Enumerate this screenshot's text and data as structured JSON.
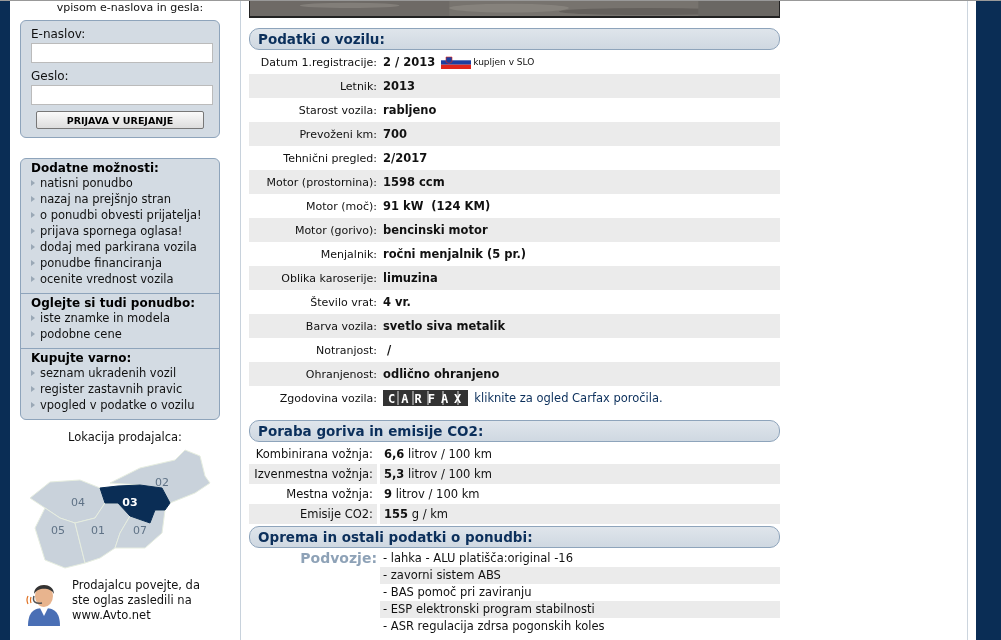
{
  "sidebar": {
    "login_intro": "vpisom e-naslova in gesla:",
    "login": {
      "email_label": "E-naslov:",
      "password_label": "Geslo:",
      "button": "PRIJAVA V UREJANJE"
    },
    "menus": [
      {
        "title": "Dodatne možnosti:",
        "items": [
          "natisni ponudbo",
          "nazaj na prejšnjo stran",
          "o ponudbi obvesti prijatelja!",
          "prijava spornega oglasa!",
          "dodaj med parkirana vozila",
          "ponudbe financiranja",
          "ocenite vrednost vozila"
        ]
      },
      {
        "title": "Oglejte si tudi ponudbo:",
        "items": [
          "iste znamke in modela",
          "podobne cene"
        ]
      },
      {
        "title": "Kupujte varno:",
        "items": [
          "seznam ukradenih vozil",
          "register zastavnih pravic",
          "vpogled v podatke o vozilu"
        ]
      }
    ],
    "location_title": "Lokacija prodajalca:",
    "map_regions": [
      {
        "label": "02",
        "selected": false
      },
      {
        "label": "04",
        "selected": false
      },
      {
        "label": "05",
        "selected": false
      },
      {
        "label": "01",
        "selected": false
      },
      {
        "label": "07",
        "selected": false
      },
      {
        "label": "03",
        "selected": true
      }
    ],
    "contact_note": "Prodajalcu povejte, da ste oglas zasledili na www.Avto.net"
  },
  "main": {
    "vehicle": {
      "title": "Podatki o vozilu:",
      "rows": [
        {
          "kind": "text",
          "label": "Datum 1.registracije:",
          "value": "2 / 2013",
          "note": "kupljen v SLO"
        },
        {
          "kind": "text",
          "label": "Letnik:",
          "value": "2013"
        },
        {
          "kind": "text",
          "label": "Starost vozila:",
          "value": "rabljeno"
        },
        {
          "kind": "text",
          "label": "Prevoženi km:",
          "value": "700"
        },
        {
          "kind": "text",
          "label": "Tehnični pregled:",
          "value": "2/2017"
        },
        {
          "kind": "text",
          "label": "Motor (prostornina):",
          "value": "1598 ccm"
        },
        {
          "kind": "text",
          "label": "Motor (moč):",
          "value": "91 kW  (124 KM)"
        },
        {
          "kind": "text",
          "label": "Motor (gorivo):",
          "value": "bencinski motor"
        },
        {
          "kind": "text",
          "label": "Menjalnik:",
          "value": "ročni menjalnik (5 pr.)"
        },
        {
          "kind": "text",
          "label": "Oblika karoserije:",
          "value": "limuzina"
        },
        {
          "kind": "text",
          "label": "Število vrat:",
          "value": "4 vr."
        },
        {
          "kind": "text",
          "label": "Barva vozila:",
          "value": "svetlo siva metalik"
        },
        {
          "kind": "text",
          "label": "Notranjost:",
          "value": " /"
        },
        {
          "kind": "text",
          "label": "Ohranjenost:",
          "value": "odlično ohranjeno"
        },
        {
          "kind": "carfax",
          "label": "Zgodovina vozila:",
          "logo": "CARFAX",
          "link": "kliknite za ogled Carfax poročila."
        }
      ]
    },
    "fuel": {
      "title": "Poraba goriva in emisije CO2:",
      "rows": [
        {
          "label": "Kombinirana vožnja:",
          "value": "**6,6** litrov / 100 km"
        },
        {
          "label": "Izvenmestna vožnja:",
          "value": "**5,3** litrov / 100 km"
        },
        {
          "label": "Mestna vožnja:",
          "value": "**9** litrov / 100 km"
        },
        {
          "label": "Emisije CO2:",
          "value": "**155** g / km"
        }
      ]
    },
    "equipment": {
      "title": "Oprema in ostali podatki o ponudbi:",
      "groups": [
        {
          "label": "Podvozje:",
          "items": [
            "- lahka - ALU platišča:original -16",
            "- zavorni sistem ABS",
            "- BAS pomoč pri zaviranju",
            "- ESP elektronski program stabilnosti",
            "- ASR regulacija zdrsa pogonskih koles"
          ]
        }
      ]
    }
  }
}
